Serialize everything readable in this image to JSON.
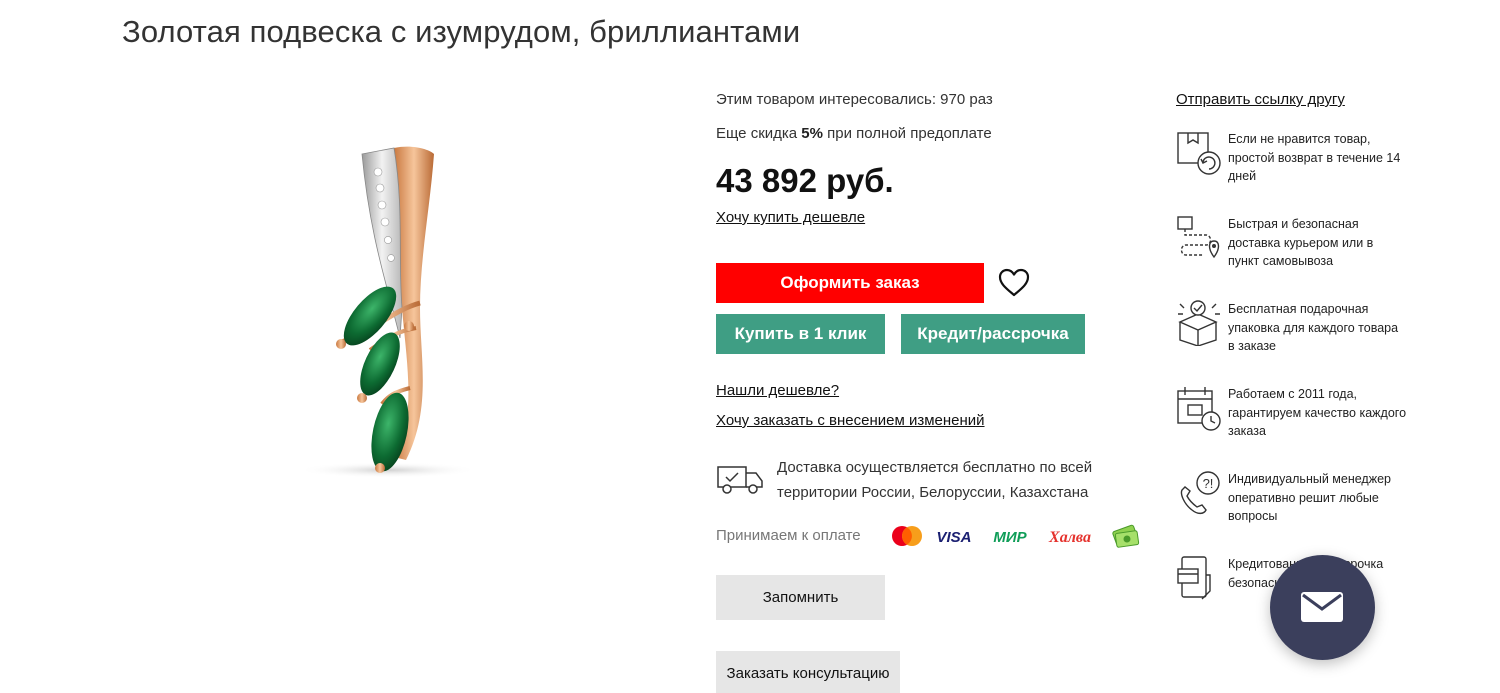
{
  "product": {
    "title": "Золотая подвеска с изумрудом, бриллиантами"
  },
  "info": {
    "interest_text": "Этим товаром интересовались: 970 раз",
    "discount_prefix": "Еще скидка ",
    "discount_value": "5%",
    "discount_suffix": " при полной предоплате",
    "price": "43 892 руб.",
    "want_cheaper_link": "Хочу купить дешевле",
    "order_button": "Оформить заказ",
    "favorite_icon": "heart-icon",
    "one_click_button": "Купить в 1 клик",
    "credit_button": "Кредит/рассрочка",
    "found_cheaper_link": "Нашли дешевле?",
    "order_with_changes_link": "Хочу заказать с внесением изменений",
    "delivery_text": "Доставка осуществляется бесплатно по всей территории России, Белоруссии, Казахстана",
    "payment_label": "Принимаем к оплате",
    "payment_methods": [
      "Mastercard",
      "VISA",
      "МИР",
      "Халва",
      "cash"
    ],
    "remember_button": "Запомнить",
    "consult_button": "Заказать консультацию"
  },
  "sidebar": {
    "share_link": "Отправить ссылку другу",
    "features": [
      {
        "icon": "return-box-icon",
        "text": "Если не нравится товар, простой возврат в течение 14 дней"
      },
      {
        "icon": "delivery-route-icon",
        "text": "Быстрая и безопасная доставка курьером или в пункт самовывоза"
      },
      {
        "icon": "gift-box-icon",
        "text": "Бесплатная подарочная упаковка для каждого товара в заказе"
      },
      {
        "icon": "calendar-clock-icon",
        "text": "Работаем с 2011 года, гарантируем качество каждого заказа"
      },
      {
        "icon": "support-phone-icon",
        "text": "Индивидуальный менеджер оперативно решит любые вопросы"
      },
      {
        "icon": "credit-card-hand-icon",
        "text": "Кредитование и рассрочка безопасно"
      }
    ]
  },
  "colors": {
    "order_red": "#ff0000",
    "teal": "#3f9e84",
    "gray_button": "#e6e6e6",
    "chat_button": "#3b3f5c"
  },
  "chat_icon": "mail-icon"
}
